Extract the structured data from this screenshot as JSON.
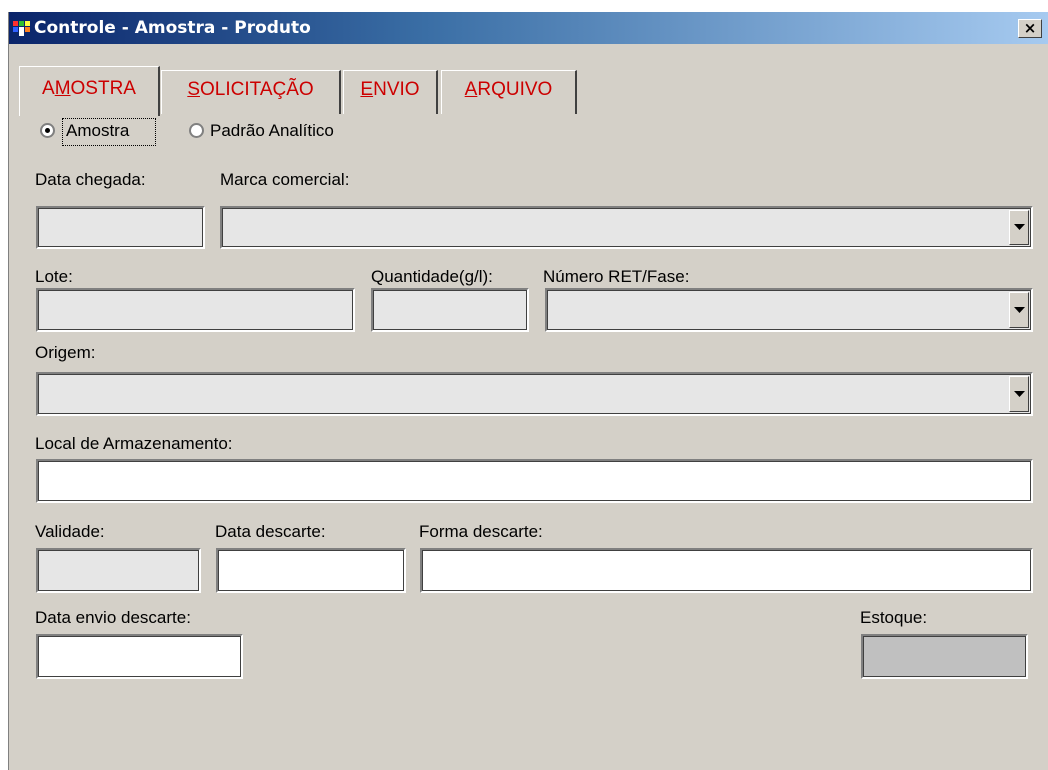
{
  "window": {
    "title": "Controle - Amostra - Produto",
    "close_label": "×"
  },
  "tabs": [
    {
      "pre": "A",
      "key": "M",
      "post": "OSTRA"
    },
    {
      "pre": "",
      "key": "S",
      "post": "OLICITAÇÃO"
    },
    {
      "pre": "",
      "key": "E",
      "post": "NVIO"
    },
    {
      "pre": "",
      "key": "A",
      "post": "RQUIVO"
    }
  ],
  "radios": [
    {
      "label": "Amostra",
      "selected": true
    },
    {
      "label": "Padrão Analítico",
      "selected": false
    }
  ],
  "labels": {
    "data_chegada": "Data chegada:",
    "marca_comercial": "Marca comercial:",
    "lote": "Lote:",
    "quantidade": "Quantidade(g/l):",
    "numero_ret": "Número RET/Fase:",
    "origem": "Origem:",
    "local_armazenamento": "Local de Armazenamento:",
    "validade": "Validade:",
    "data_descarte": "Data descarte:",
    "forma_descarte": "Forma descarte:",
    "data_envio_descarte": "Data envio descarte:",
    "estoque": "Estoque:"
  },
  "values": {
    "data_chegada": "",
    "marca_comercial": "",
    "lote": "",
    "quantidade": "",
    "numero_ret": "",
    "origem": "",
    "local_armazenamento": "",
    "validade": "",
    "data_descarte": "",
    "forma_descarte": "",
    "data_envio_descarte": "",
    "estoque": ""
  },
  "colors": {
    "tab_text": "#cc0000",
    "title_bar_start": "#0a246a",
    "window_bg": "#d4d0c8"
  }
}
